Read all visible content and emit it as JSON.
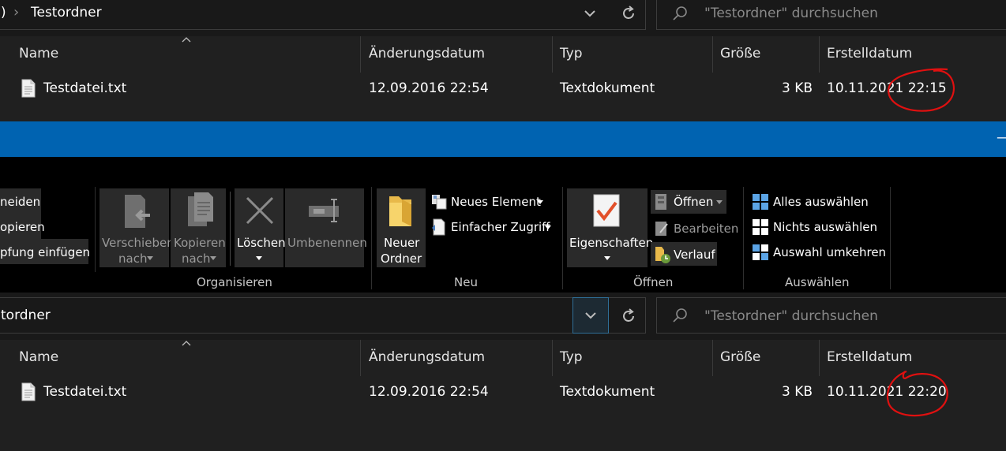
{
  "top": {
    "breadcrumb_prefix": ")",
    "breadcrumb_sep": "›",
    "folder": "Testordner",
    "search_placeholder": "\"Testordner\" durchsuchen"
  },
  "columns": {
    "name": "Name",
    "modified": "Änderungsdatum",
    "type": "Typ",
    "size": "Größe",
    "created": "Erstelldatum"
  },
  "file_top": {
    "name": "Testdatei.txt",
    "modified": "12.09.2016 22:54",
    "type": "Textdokument",
    "size": "3 KB",
    "created": "10.11.2021 22:15"
  },
  "ribbon": {
    "clipboard_items": [
      "neiden",
      "opieren",
      "pfung einfügen"
    ],
    "move_label_1": "Verschieben",
    "move_label_2": "nach",
    "copy_label_1": "Kopieren",
    "copy_label_2": "nach",
    "delete_label": "Löschen",
    "rename_label": "Umbenennen",
    "new_folder_1": "Neuer",
    "new_folder_2": "Ordner",
    "new_element": "Neues Element",
    "easy_access": "Einfacher Zugriff",
    "properties": "Eigenschaften",
    "open": "Öffnen",
    "edit": "Bearbeiten",
    "history": "Verlauf",
    "select_all": "Alles auswählen",
    "select_none": "Nichts auswählen",
    "invert_selection": "Auswahl umkehren",
    "groups": {
      "organize": "Organisieren",
      "new": "Neu",
      "open": "Öffnen",
      "select": "Auswählen"
    },
    "colors": {
      "ribbon_bg": "#000000",
      "button_bg": "#2a2a2a",
      "title_bar": "#0063b1"
    }
  },
  "bottom": {
    "folder": "tordner",
    "search_placeholder": "\"Testordner\" durchsuchen"
  },
  "file_bottom": {
    "name": "Testdatei.txt",
    "modified": "12.09.2016 22:54",
    "type": "Textdokument",
    "size": "3 KB",
    "created": "10.11.2021 22:20"
  },
  "window": {
    "minimize": "—"
  }
}
